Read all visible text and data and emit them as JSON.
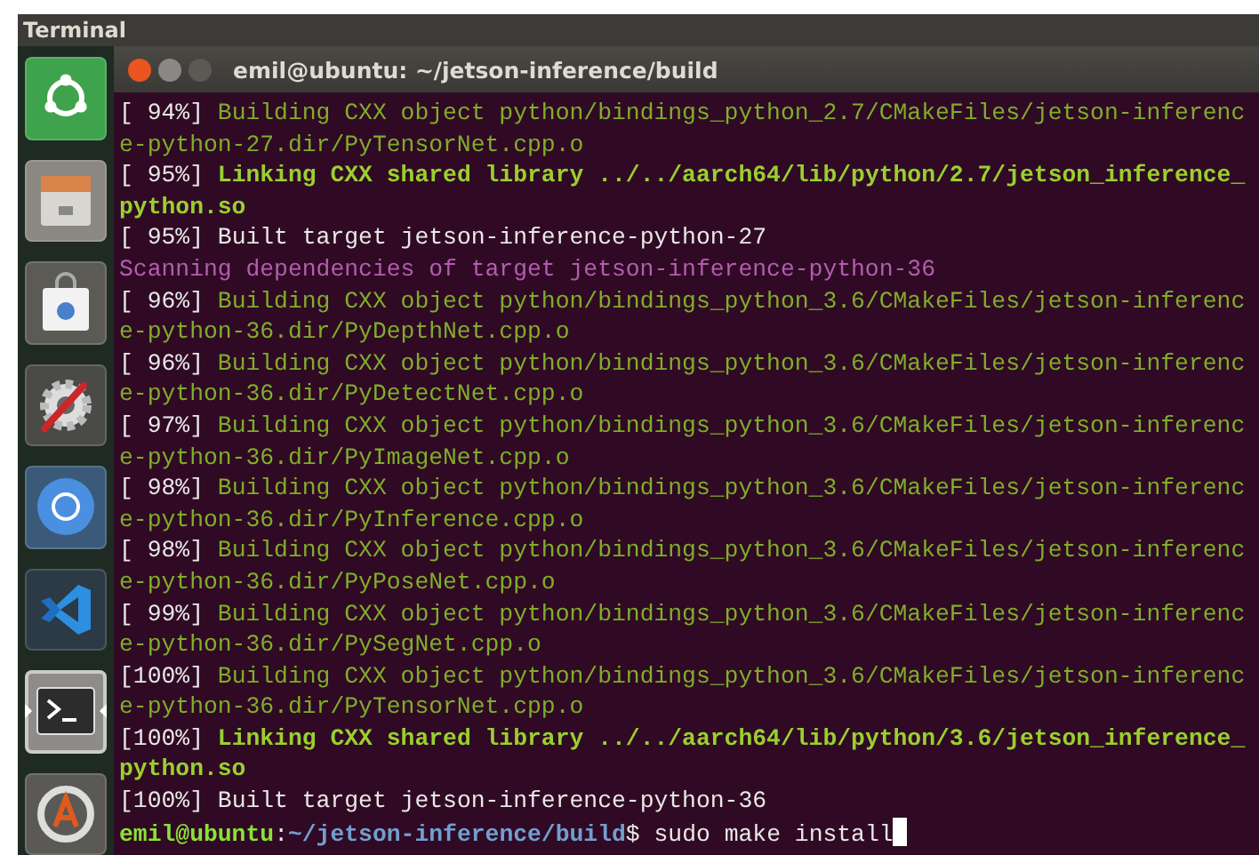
{
  "top_panel": {
    "title": "Terminal"
  },
  "launcher": [
    {
      "kind": "ubuntu",
      "active": false
    },
    {
      "kind": "files",
      "active": false
    },
    {
      "kind": "store",
      "active": false
    },
    {
      "kind": "settings",
      "active": false
    },
    {
      "kind": "browser",
      "active": false
    },
    {
      "kind": "editor",
      "active": false
    },
    {
      "kind": "terminal",
      "active": true
    },
    {
      "kind": "updater",
      "active": false
    }
  ],
  "window": {
    "title": "emil@ubuntu: ~/jetson-inference/build"
  },
  "lines": [
    {
      "kind": "build",
      "progress": "[ 94%]",
      "text": "Building CXX object python/bindings_python_2.7/CMakeFiles/jetson-inferenc"
    },
    {
      "kind": "build",
      "text": "e-python-27.dir/PyTensorNet.cpp.o"
    },
    {
      "kind": "link",
      "progress": "[ 95%]",
      "text": "Linking CXX shared library ../../aarch64/lib/python/2.7/jetson_inference_"
    },
    {
      "kind": "link",
      "text": "python.so"
    },
    {
      "kind": "built",
      "progress": "[ 95%]",
      "text": "Built target jetson-inference-python-27"
    },
    {
      "kind": "scan",
      "text": "Scanning dependencies of target jetson-inference-python-36"
    },
    {
      "kind": "build",
      "progress": "[ 96%]",
      "text": "Building CXX object python/bindings_python_3.6/CMakeFiles/jetson-inferenc"
    },
    {
      "kind": "build",
      "text": "e-python-36.dir/PyDepthNet.cpp.o"
    },
    {
      "kind": "build",
      "progress": "[ 96%]",
      "text": "Building CXX object python/bindings_python_3.6/CMakeFiles/jetson-inferenc"
    },
    {
      "kind": "build",
      "text": "e-python-36.dir/PyDetectNet.cpp.o"
    },
    {
      "kind": "build",
      "progress": "[ 97%]",
      "text": "Building CXX object python/bindings_python_3.6/CMakeFiles/jetson-inferenc"
    },
    {
      "kind": "build",
      "text": "e-python-36.dir/PyImageNet.cpp.o"
    },
    {
      "kind": "build",
      "progress": "[ 98%]",
      "text": "Building CXX object python/bindings_python_3.6/CMakeFiles/jetson-inferenc"
    },
    {
      "kind": "build",
      "text": "e-python-36.dir/PyInference.cpp.o"
    },
    {
      "kind": "build",
      "progress": "[ 98%]",
      "text": "Building CXX object python/bindings_python_3.6/CMakeFiles/jetson-inferenc"
    },
    {
      "kind": "build",
      "text": "e-python-36.dir/PyPoseNet.cpp.o"
    },
    {
      "kind": "build",
      "progress": "[ 99%]",
      "text": "Building CXX object python/bindings_python_3.6/CMakeFiles/jetson-inferenc"
    },
    {
      "kind": "build",
      "text": "e-python-36.dir/PySegNet.cpp.o"
    },
    {
      "kind": "build",
      "progress": "[100%]",
      "text": "Building CXX object python/bindings_python_3.6/CMakeFiles/jetson-inferenc"
    },
    {
      "kind": "build",
      "text": "e-python-36.dir/PyTensorNet.cpp.o"
    },
    {
      "kind": "link",
      "progress": "[100%]",
      "text": "Linking CXX shared library ../../aarch64/lib/python/3.6/jetson_inference_"
    },
    {
      "kind": "link",
      "text": "python.so"
    },
    {
      "kind": "built",
      "progress": "[100%]",
      "text": "Built target jetson-inference-python-36"
    }
  ],
  "prompt": {
    "user": "emil@ubuntu",
    "separator": ":",
    "path": "~/jetson-inference/build",
    "symbol": "$",
    "command": "sudo make install"
  }
}
